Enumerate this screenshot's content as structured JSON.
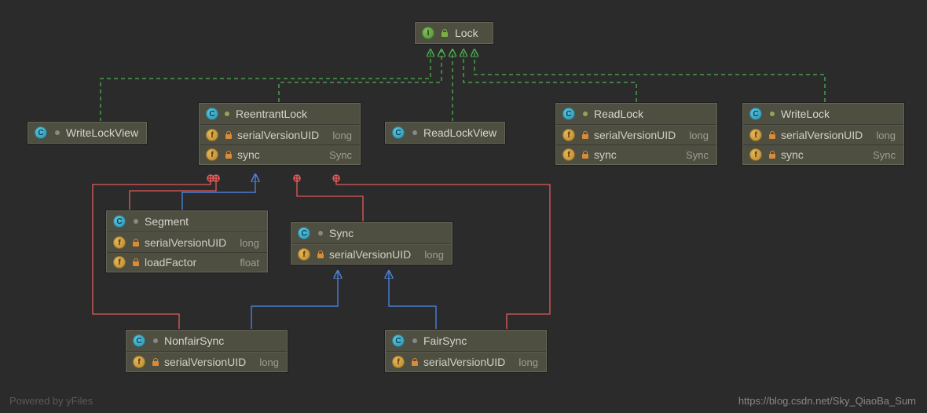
{
  "diagram": {
    "root": {
      "name": "Lock",
      "kind": "interface"
    },
    "writeLockView": {
      "name": "WriteLockView",
      "kind": "class"
    },
    "readLockView": {
      "name": "ReadLockView",
      "kind": "class"
    },
    "reentrantLock": {
      "name": "ReentrantLock",
      "kind": "class",
      "fields": [
        {
          "name": "serialVersionUID",
          "type": "long"
        },
        {
          "name": "sync",
          "type": "Sync"
        }
      ]
    },
    "readLock": {
      "name": "ReadLock",
      "kind": "class",
      "fields": [
        {
          "name": "serialVersionUID",
          "type": "long"
        },
        {
          "name": "sync",
          "type": "Sync"
        }
      ]
    },
    "writeLock": {
      "name": "WriteLock",
      "kind": "class",
      "fields": [
        {
          "name": "serialVersionUID",
          "type": "long"
        },
        {
          "name": "sync",
          "type": "Sync"
        }
      ]
    },
    "segment": {
      "name": "Segment",
      "kind": "class",
      "fields": [
        {
          "name": "serialVersionUID",
          "type": "long"
        },
        {
          "name": "loadFactor",
          "type": "float"
        }
      ]
    },
    "sync": {
      "name": "Sync",
      "kind": "class",
      "fields": [
        {
          "name": "serialVersionUID",
          "type": "long"
        }
      ]
    },
    "nonfairSync": {
      "name": "NonfairSync",
      "kind": "class",
      "fields": [
        {
          "name": "serialVersionUID",
          "type": "long"
        }
      ]
    },
    "fairSync": {
      "name": "FairSync",
      "kind": "class",
      "fields": [
        {
          "name": "serialVersionUID",
          "type": "long"
        }
      ]
    }
  },
  "edges": {
    "implements": [
      {
        "from": "writeLockView",
        "to": "root"
      },
      {
        "from": "reentrantLock",
        "to": "root"
      },
      {
        "from": "readLockView",
        "to": "root"
      },
      {
        "from": "readLock",
        "to": "root"
      },
      {
        "from": "writeLock",
        "to": "root"
      }
    ],
    "extends": [
      {
        "from": "segment",
        "to": "reentrantLock"
      },
      {
        "from": "nonfairSync",
        "to": "sync"
      },
      {
        "from": "fairSync",
        "to": "sync"
      }
    ],
    "innerClass": [
      {
        "from": "segment",
        "to": "reentrantLock"
      },
      {
        "from": "sync",
        "to": "reentrantLock"
      },
      {
        "from": "nonfairSync",
        "to": "reentrantLock"
      },
      {
        "from": "fairSync",
        "to": "reentrantLock"
      }
    ]
  },
  "colors": {
    "implements": "#4caf50",
    "extends": "#4a7fd4",
    "inner": "#e05a5a",
    "nodeBg": "#4e4e41"
  },
  "footer": {
    "left": "Powered by yFiles",
    "right": "https://blog.csdn.net/Sky_QiaoBa_Sum"
  }
}
